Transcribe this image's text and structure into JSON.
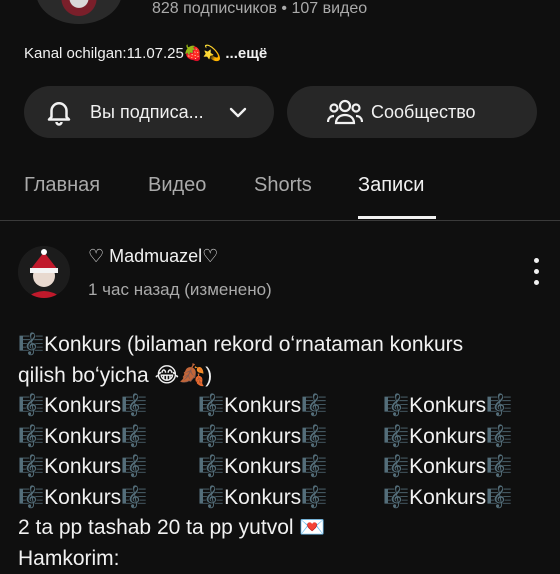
{
  "channel": {
    "stats": "828 подписчиков • 107 видео",
    "description_prefix": "Kanal ochilgan:11.07.25🍓💫 ",
    "more_label": "...ещё"
  },
  "actions": {
    "subscribed_label": "Вы подписа...",
    "community_label": "Сообщество"
  },
  "tabs": [
    {
      "label": "Главная"
    },
    {
      "label": "Видео"
    },
    {
      "label": "Shorts"
    },
    {
      "label": "Записи",
      "active": true
    }
  ],
  "post": {
    "author": "♡ Madmuazel♡",
    "time": "1 час назад (изменено)",
    "line1": "🎼Konkurs (bilaman rekord oʻrnataman konkurs",
    "line2": "qilish boʻyicha 😂🍂)",
    "konkurs_word": "Konkurs",
    "note_glyph": "🎼",
    "konkurs_rows": 4,
    "line_prize": "2 ta pp tashab 20 ta pp yutvol 💌",
    "line_partner": "Hamkorim:"
  },
  "colors": {
    "background": "#0f0f0f",
    "pill": "#272727",
    "text": "#f1f1f1",
    "muted": "#aaaaaa"
  }
}
